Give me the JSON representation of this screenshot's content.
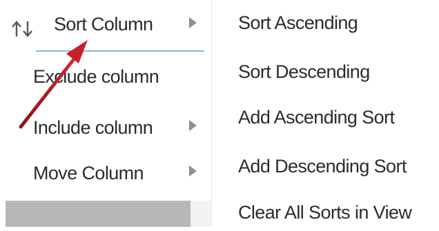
{
  "context_menu": {
    "items": [
      {
        "label": "Sort Column",
        "icon": "sort-up-down-icon",
        "has_submenu": true
      },
      {
        "label": "Exclude column",
        "has_submenu": false
      },
      {
        "label": "Include column",
        "has_submenu": true
      },
      {
        "label": "Move Column",
        "has_submenu": true
      }
    ]
  },
  "submenu": {
    "items": [
      {
        "label": "Sort Ascending"
      },
      {
        "label": "Sort Descending"
      },
      {
        "label": "Add Ascending Sort"
      },
      {
        "label": "Add Descending Sort"
      },
      {
        "label": "Clear All Sorts in View"
      }
    ]
  },
  "annotation": {
    "arrow_color": "#c8202a"
  },
  "colors": {
    "text": "#2b2b2b",
    "separator": "#8cb4dc",
    "submenu_arrow": "#8f8f8f",
    "scroll_region": "#b7b7b7"
  }
}
